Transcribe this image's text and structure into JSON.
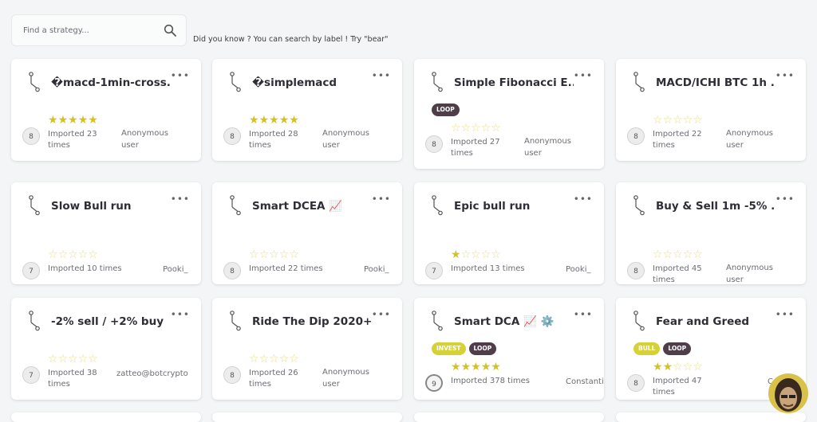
{
  "search": {
    "placeholder": "Find a strategy..."
  },
  "hint": "Did you know ? You can search by label ! Try \"bear\"",
  "cards": [
    {
      "title": "�macd-1min-cross...",
      "rating": 5,
      "avatar": "8",
      "imports": "Imported 23 times",
      "author": "Anonymous user",
      "labels": []
    },
    {
      "title": "�simplemacd",
      "rating": 5,
      "avatar": "8",
      "imports": "Imported 28 times",
      "author": "Anonymous user",
      "labels": []
    },
    {
      "title": "Simple Fibonacci E...",
      "rating": 0,
      "avatar": "8",
      "imports": "Imported 27 times",
      "author": "Anonymous user",
      "labels": [
        "LOOP"
      ]
    },
    {
      "title": "MACD/ICHI BTC 1h ...",
      "rating": 0,
      "avatar": "8",
      "imports": "Imported 22 times",
      "author": "Anonymous user",
      "labels": []
    },
    {
      "title": "Slow Bull run",
      "rating": 0,
      "avatar": "7",
      "imports": "Imported 10 times",
      "author": "Pooki_",
      "labels": []
    },
    {
      "title": "Smart DCEA 📈",
      "rating": 0,
      "avatar": "8",
      "imports": "Imported 22 times",
      "author": "Pooki_",
      "labels": []
    },
    {
      "title": "Epic bull run",
      "rating": 1,
      "avatar": "7",
      "imports": "Imported 13 times",
      "author": "Pooki_",
      "labels": []
    },
    {
      "title": "Buy & Sell 1m -5% ...",
      "rating": 0,
      "avatar": "8",
      "imports": "Imported 45 times",
      "author": "Anonymous user",
      "labels": []
    },
    {
      "title": "-2% sell / +2% buy",
      "rating": 0,
      "avatar": "7",
      "imports": "Imported 38 times",
      "author": "zatteo@botcrypto",
      "labels": []
    },
    {
      "title": "Ride The Dip 2020+",
      "rating": 0,
      "avatar": "8",
      "imports": "Imported 26 times",
      "author": "Anonymous user",
      "labels": []
    },
    {
      "title": "Smart DCA 📈 ⚙️",
      "rating": 5,
      "avatar": "9",
      "imports": "Imported 378 times",
      "author": "Constantin",
      "labels": [
        "INVEST",
        "LOOP"
      ]
    },
    {
      "title": "Fear and Greed",
      "rating": 2,
      "avatar": "8",
      "imports": "Imported 47 times",
      "author": "Cons",
      "labels": [
        "BULL",
        "LOOP"
      ]
    }
  ],
  "colors": {
    "accent_star": "#d4c225",
    "loop_label": "#4f3e4a",
    "yellow_label": "#d6d236"
  }
}
